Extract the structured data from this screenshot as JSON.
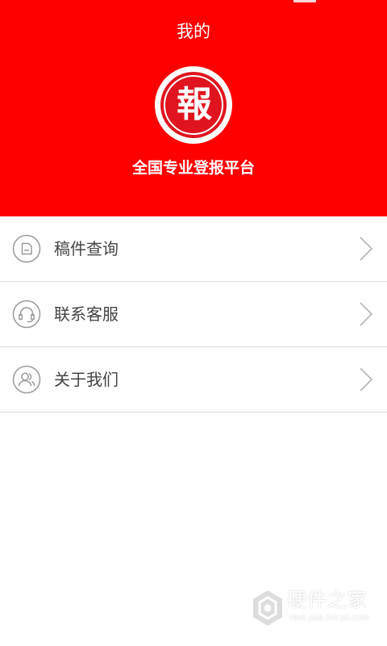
{
  "header": {
    "title": "我的",
    "logo_char": "報",
    "tagline": "全国专业登报平台",
    "background_color": "#ff0000"
  },
  "menu": {
    "items": [
      {
        "label": "稿件查询",
        "icon": "document-icon"
      },
      {
        "label": "联系客服",
        "icon": "headset-icon"
      },
      {
        "label": "关于我们",
        "icon": "people-icon"
      }
    ]
  },
  "watermark": {
    "name": "硬件之家",
    "pinyin": "YING JIAN ZHI JIA.COM"
  }
}
